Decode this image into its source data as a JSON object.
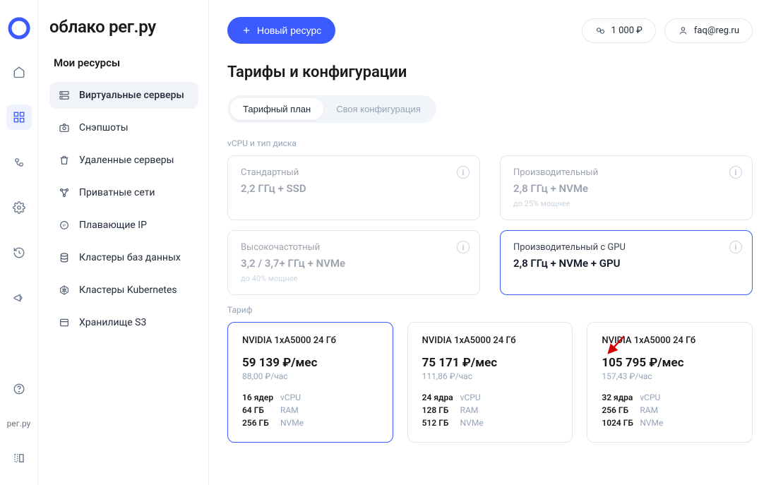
{
  "brand": "облако рег.ру",
  "brand_short": "рег.ру",
  "sidebar": {
    "section": "Мои ресурсы",
    "items": [
      {
        "label": "Виртуальные серверы",
        "icon": "server-icon"
      },
      {
        "label": "Снэпшоты",
        "icon": "camera-icon"
      },
      {
        "label": "Удаленные серверы",
        "icon": "trash-icon"
      },
      {
        "label": "Приватные сети",
        "icon": "network-icon"
      },
      {
        "label": "Плавающие IP",
        "icon": "ip-icon"
      },
      {
        "label": "Кластеры баз данных",
        "icon": "database-icon"
      },
      {
        "label": "Кластеры Kubernetes",
        "icon": "kubernetes-icon"
      },
      {
        "label": "Хранилище S3",
        "icon": "storage-icon"
      }
    ]
  },
  "topbar": {
    "new_resource": "Новый ресурс",
    "balance": "1 000 ₽",
    "account": "faq@reg.ru"
  },
  "page": {
    "title": "Тарифы и конфигурации",
    "seg_plan": "Тарифный план",
    "seg_custom": "Своя конфигурация",
    "vcpu_label": "vCPU и тип диска",
    "tariff_label": "Тариф"
  },
  "tiers": [
    {
      "title": "Стандартный",
      "spec": "2,2 ГГц + SSD",
      "sub": ""
    },
    {
      "title": "Производительный",
      "spec": "2,8 ГГц + NVMe",
      "sub": "до 25% мощнее"
    },
    {
      "title": "Высокочастотный",
      "spec": "3,2 / 3,7+ ГГц + NVMe",
      "sub": "до 40% мощнее"
    },
    {
      "title": "Производительный с GPU",
      "spec": "2,8 ГГц + NVMe + GPU",
      "sub": ""
    }
  ],
  "tariffs": [
    {
      "gpu": "NVIDIA 1xA5000 24 Гб",
      "price": "59 139 ₽/мес",
      "hourly": "88,00 ₽/час",
      "cores": "16 ядер",
      "cores_l": "vCPU",
      "ram": "64 ГБ",
      "ram_l": "RAM",
      "disk": "256 ГБ",
      "disk_l": "NVMe"
    },
    {
      "gpu": "NVIDIA 1xA5000 24 Гб",
      "price": "75 171 ₽/мес",
      "hourly": "111,86 ₽/час",
      "cores": "24 ядра",
      "cores_l": "vCPU",
      "ram": "128 ГБ",
      "ram_l": "RAM",
      "disk": "512 ГБ",
      "disk_l": "NVMe"
    },
    {
      "gpu": "NVIDIA 1xA5000 24 Гб",
      "price": "105 795 ₽/мес",
      "hourly": "157,43 ₽/час",
      "cores": "32 ядра",
      "cores_l": "vCPU",
      "ram": "256 ГБ",
      "ram_l": "RAM",
      "disk": "1024 ГБ",
      "disk_l": "NVMe"
    }
  ],
  "colors": {
    "primary": "#3b5bff",
    "arrow": "#d40000"
  }
}
